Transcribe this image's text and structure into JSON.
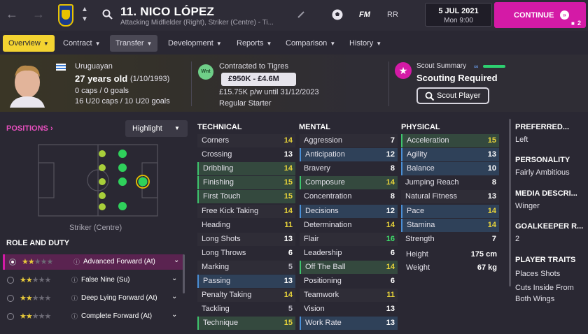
{
  "header": {
    "title": "11. NICO LÓPEZ",
    "subtitle": "Attacking Midfielder (Right), Striker (Centre) - Ti...",
    "fm_label": "FM",
    "rr_label": "RR",
    "date": "5 JUL 2021",
    "time": "Mon 9:00",
    "continue_label": "CONTINUE",
    "notification_count": "2"
  },
  "tabs": [
    {
      "label": "Overview",
      "active": true
    },
    {
      "label": "Contract"
    },
    {
      "label": "Transfer",
      "hover": true
    },
    {
      "label": "Development"
    },
    {
      "label": "Reports"
    },
    {
      "label": "Comparison"
    },
    {
      "label": "History"
    }
  ],
  "player": {
    "nationality": "Uruguayan",
    "age": "27 years old",
    "dob": "(1/10/1993)",
    "caps": "0 caps / 0 goals",
    "u20": "16 U20 caps / 10 U20 goals"
  },
  "contract": {
    "badge": "Wnt",
    "status": "Contracted to Tigres",
    "value": "£950K - £4.6M",
    "wage": "£15.75K p/w until 31/12/2023",
    "role": "Regular Starter"
  },
  "scout": {
    "title": "Scout Summary",
    "status": "Scouting Required",
    "button": "Scout Player"
  },
  "positions": {
    "title": "POSITIONS",
    "filter": "Highlight",
    "caption": "Striker (Centre)"
  },
  "role_duty": {
    "title": "ROLE AND DUTY",
    "roles": [
      {
        "name": "Advanced Forward (At)",
        "stars": 2,
        "selected": true
      },
      {
        "name": "False Nine (Su)",
        "stars": 2
      },
      {
        "name": "Deep Lying Forward (At)",
        "stars": 2
      },
      {
        "name": "Complete Forward (At)",
        "stars": 2
      }
    ]
  },
  "technical": {
    "title": "TECHNICAL",
    "items": [
      {
        "name": "Corners",
        "value": "14",
        "hl": "plain",
        "color": "yellow"
      },
      {
        "name": "Crossing",
        "value": "13",
        "hl": "none",
        "color": "white"
      },
      {
        "name": "Dribbling",
        "value": "14",
        "hl": "green",
        "color": "yellow"
      },
      {
        "name": "Finishing",
        "value": "15",
        "hl": "green",
        "color": "yellow"
      },
      {
        "name": "First Touch",
        "value": "15",
        "hl": "green",
        "color": "yellow"
      },
      {
        "name": "Free Kick Taking",
        "value": "14",
        "hl": "plain",
        "color": "yellow"
      },
      {
        "name": "Heading",
        "value": "11",
        "hl": "none",
        "color": "yellow"
      },
      {
        "name": "Long Shots",
        "value": "13",
        "hl": "plain",
        "color": "white"
      },
      {
        "name": "Long Throws",
        "value": "6",
        "hl": "none",
        "color": "white"
      },
      {
        "name": "Marking",
        "value": "5",
        "hl": "plain",
        "color": "grey"
      },
      {
        "name": "Passing",
        "value": "13",
        "hl": "blue",
        "color": "white"
      },
      {
        "name": "Penalty Taking",
        "value": "14",
        "hl": "plain",
        "color": "yellow"
      },
      {
        "name": "Tackling",
        "value": "5",
        "hl": "none",
        "color": "grey"
      },
      {
        "name": "Technique",
        "value": "15",
        "hl": "green",
        "color": "yellow"
      }
    ]
  },
  "mental": {
    "title": "MENTAL",
    "items": [
      {
        "name": "Aggression",
        "value": "7",
        "hl": "plain",
        "color": "white"
      },
      {
        "name": "Anticipation",
        "value": "12",
        "hl": "blue",
        "color": "white"
      },
      {
        "name": "Bravery",
        "value": "8",
        "hl": "none",
        "color": "white"
      },
      {
        "name": "Composure",
        "value": "14",
        "hl": "green",
        "color": "yellow"
      },
      {
        "name": "Concentration",
        "value": "8",
        "hl": "none",
        "color": "white"
      },
      {
        "name": "Decisions",
        "value": "12",
        "hl": "blue",
        "color": "white"
      },
      {
        "name": "Determination",
        "value": "14",
        "hl": "none",
        "color": "yellow"
      },
      {
        "name": "Flair",
        "value": "16",
        "hl": "plain",
        "color": "green"
      },
      {
        "name": "Leadership",
        "value": "6",
        "hl": "none",
        "color": "white"
      },
      {
        "name": "Off The Ball",
        "value": "14",
        "hl": "green",
        "color": "yellow"
      },
      {
        "name": "Positioning",
        "value": "6",
        "hl": "none",
        "color": "white"
      },
      {
        "name": "Teamwork",
        "value": "11",
        "hl": "plain",
        "color": "yellow"
      },
      {
        "name": "Vision",
        "value": "13",
        "hl": "none",
        "color": "white"
      },
      {
        "name": "Work Rate",
        "value": "13",
        "hl": "blue",
        "color": "white"
      }
    ]
  },
  "physical": {
    "title": "PHYSICAL",
    "items": [
      {
        "name": "Acceleration",
        "value": "15",
        "hl": "green",
        "color": "yellow"
      },
      {
        "name": "Agility",
        "value": "13",
        "hl": "blue",
        "color": "white"
      },
      {
        "name": "Balance",
        "value": "10",
        "hl": "blue",
        "color": "white"
      },
      {
        "name": "Jumping Reach",
        "value": "8",
        "hl": "none",
        "color": "white"
      },
      {
        "name": "Natural Fitness",
        "value": "13",
        "hl": "plain",
        "color": "white"
      },
      {
        "name": "Pace",
        "value": "14",
        "hl": "blue",
        "color": "yellow"
      },
      {
        "name": "Stamina",
        "value": "14",
        "hl": "blue",
        "color": "yellow"
      },
      {
        "name": "Strength",
        "value": "7",
        "hl": "none",
        "color": "white"
      }
    ],
    "height_label": "Height",
    "height": "175 cm",
    "weight_label": "Weight",
    "weight": "67 kg"
  },
  "side": {
    "preferred_foot_title": "PREFERRED...",
    "preferred_foot": "Left",
    "personality_title": "PERSONALITY",
    "personality": "Fairly Ambitious",
    "media_title": "MEDIA DESCRI...",
    "media": "Winger",
    "gk_title": "GOALKEEPER R...",
    "gk": "2",
    "traits_title": "PLAYER TRAITS",
    "traits": [
      "Places Shots",
      "Cuts Inside From Both Wings"
    ]
  },
  "colors": {
    "accent": "#d41aa6",
    "tab_active": "#f3d331",
    "strong_attr": "#e7d33a",
    "elite_attr": "#3fdc6a",
    "key_green": "#3ec46d",
    "key_blue": "#4a8fd6"
  }
}
